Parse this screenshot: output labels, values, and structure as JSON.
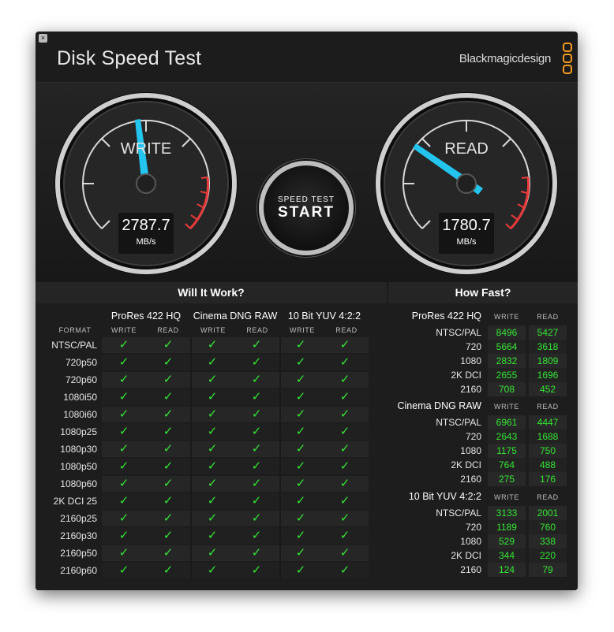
{
  "window": {
    "title": "Disk Speed Test",
    "close_icon": "close-icon"
  },
  "brand": {
    "name": "Blackmagicdesign",
    "accent": "#f39a1e"
  },
  "gauges": {
    "write": {
      "label": "WRITE",
      "value": "2787.7",
      "unit": "MB/s"
    },
    "read": {
      "label": "READ",
      "value": "1780.7",
      "unit": "MB/s"
    }
  },
  "start_button": {
    "line1": "SPEED TEST",
    "line2": "START"
  },
  "settings_icon": "gear-icon",
  "will_it_work": {
    "title": "Will It Work?",
    "format_header": "FORMAT",
    "groups": [
      "ProRes 422 HQ",
      "Cinema DNG RAW",
      "10 Bit YUV 4:2:2"
    ],
    "sub_headers": [
      "WRITE",
      "READ"
    ],
    "check_symbol": "✓",
    "formats": [
      "NTSC/PAL",
      "720p50",
      "720p60",
      "1080i50",
      "1080i60",
      "1080p25",
      "1080p30",
      "1080p50",
      "1080p60",
      "2K DCI 25",
      "2160p25",
      "2160p30",
      "2160p50",
      "2160p60"
    ]
  },
  "how_fast": {
    "title": "How Fast?",
    "sub_headers": [
      "WRITE",
      "READ"
    ],
    "groups": [
      {
        "name": "ProRes 422 HQ",
        "rows": [
          {
            "label": "NTSC/PAL",
            "write": "8496",
            "read": "5427"
          },
          {
            "label": "720",
            "write": "5664",
            "read": "3618"
          },
          {
            "label": "1080",
            "write": "2832",
            "read": "1809"
          },
          {
            "label": "2K DCI",
            "write": "2655",
            "read": "1696"
          },
          {
            "label": "2160",
            "write": "708",
            "read": "452"
          }
        ]
      },
      {
        "name": "Cinema DNG RAW",
        "rows": [
          {
            "label": "NTSC/PAL",
            "write": "6961",
            "read": "4447"
          },
          {
            "label": "720",
            "write": "2643",
            "read": "1688"
          },
          {
            "label": "1080",
            "write": "1175",
            "read": "750"
          },
          {
            "label": "2K DCI",
            "write": "764",
            "read": "488"
          },
          {
            "label": "2160",
            "write": "275",
            "read": "176"
          }
        ]
      },
      {
        "name": "10 Bit YUV 4:2:2",
        "rows": [
          {
            "label": "NTSC/PAL",
            "write": "3133",
            "read": "2001"
          },
          {
            "label": "720",
            "write": "1189",
            "read": "760"
          },
          {
            "label": "1080",
            "write": "529",
            "read": "338"
          },
          {
            "label": "2K DCI",
            "write": "344",
            "read": "220"
          },
          {
            "label": "2160",
            "write": "124",
            "read": "79"
          }
        ]
      }
    ]
  }
}
